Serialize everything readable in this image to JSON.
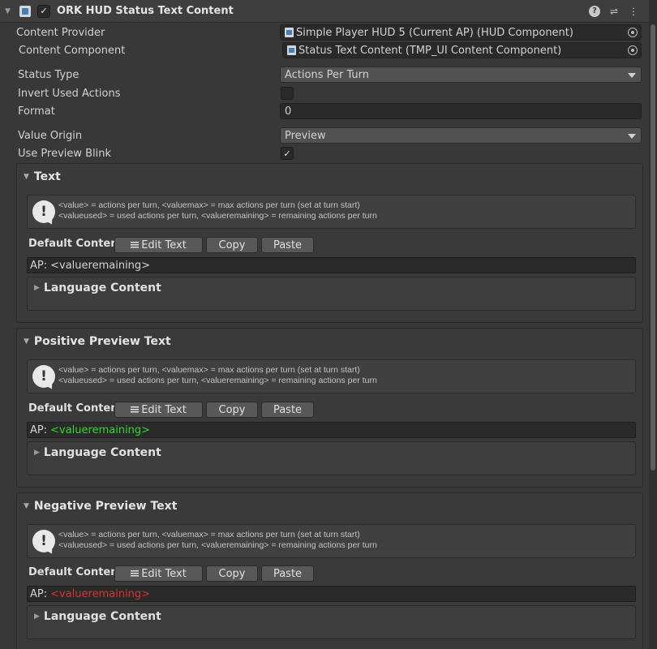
{
  "header": {
    "title": "ORK HUD Status Text Content",
    "enabled": true,
    "icons": [
      "help-icon",
      "settings-icon",
      "more-icon"
    ]
  },
  "fields": {
    "content_provider": {
      "label": "Content Provider",
      "value": "Simple Player HUD 5 (Current AP) (HUD Component)"
    },
    "content_component": {
      "label": "Content Component",
      "value": "Status Text Content (TMP_UI Content Component)"
    },
    "status_type": {
      "label": "Status Type",
      "value": "Actions Per Turn"
    },
    "invert_used": {
      "label": "Invert Used Actions",
      "checked": false
    },
    "format": {
      "label": "Format",
      "value": "0"
    },
    "value_origin": {
      "label": "Value Origin",
      "value": "Preview"
    },
    "use_preview_blink": {
      "label": "Use Preview Blink",
      "checked": true
    }
  },
  "info": {
    "line1": "<value> = actions per turn, <valuemax> = max actions per turn (set at turn start)",
    "line2": "<valueused> = used actions per turn, <valueremaining> = remaining actions per turn"
  },
  "buttons": {
    "edit_text": "Edit Text",
    "copy": "Copy",
    "paste": "Paste"
  },
  "default_content_label": "Default Content",
  "language_content_label": "Language Content",
  "sections": {
    "text": {
      "title": "Text",
      "prefix": "AP:",
      "tag": "<valueremaining>"
    },
    "positive": {
      "title": "Positive Preview Text",
      "prefix": "AP:",
      "tag": "<valueremaining>",
      "tag_color": "#2ddb2d"
    },
    "negative": {
      "title": "Negative Preview Text",
      "prefix": "AP:",
      "tag": "<valueremaining>",
      "tag_color": "#e03030"
    }
  }
}
